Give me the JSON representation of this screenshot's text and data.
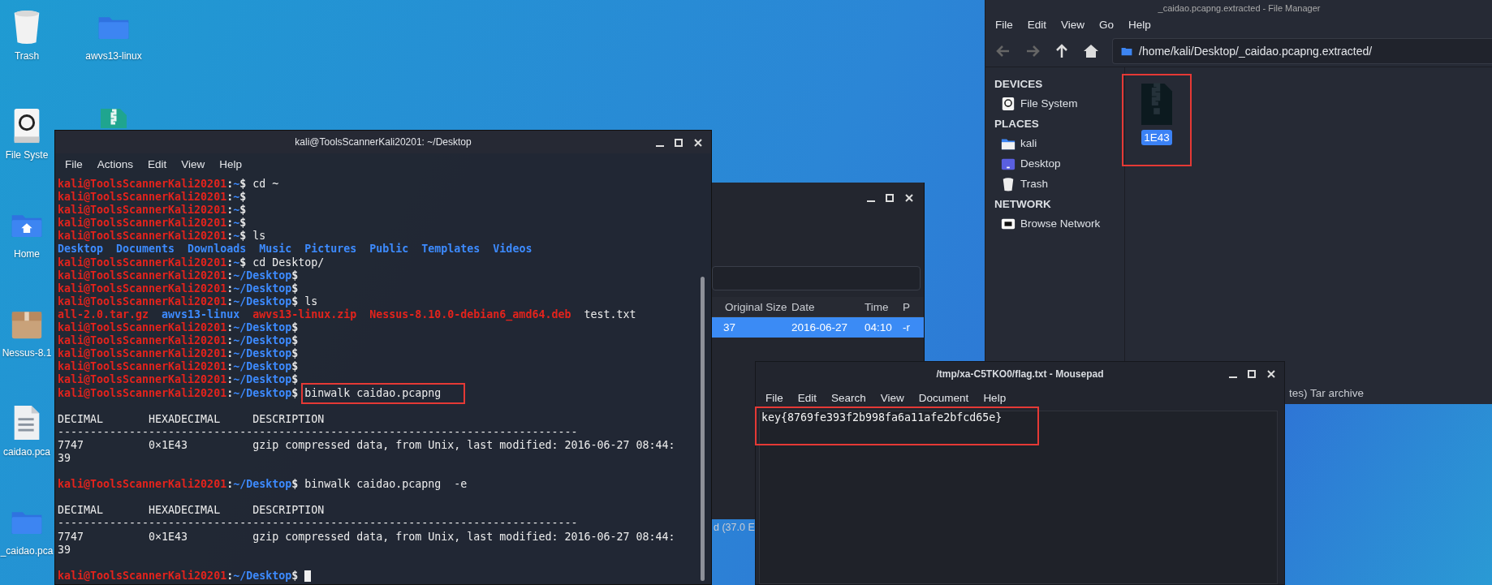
{
  "desktop": {
    "icons": [
      {
        "label": "Trash",
        "kind": "trash"
      },
      {
        "label": "awvs13-linux",
        "kind": "folder"
      },
      {
        "label": "File Syste",
        "kind": "drive"
      },
      {
        "kind": "archive"
      },
      {
        "label": "Home",
        "kind": "home"
      },
      {
        "label": "Nessus-8.1",
        "kind": "package"
      },
      {
        "label": "caidao.pca",
        "kind": "binary"
      },
      {
        "label": "_caidao.pca",
        "kind": "folder"
      }
    ]
  },
  "terminal": {
    "title": "kali@ToolsScannerKali20201: ~/Desktop",
    "menu": [
      "File",
      "Actions",
      "Edit",
      "View",
      "Help"
    ],
    "lines": [
      {
        "kind": "prompt",
        "user": "kali@ToolsScannerKali20201",
        "sep": ":",
        "path": "~",
        "sign": "$",
        "command": "cd ~"
      },
      {
        "kind": "prompt",
        "user": "kali@ToolsScannerKali20201",
        "sep": ":",
        "path": "~",
        "sign": "$"
      },
      {
        "kind": "prompt",
        "user": "kali@ToolsScannerKali20201",
        "sep": ":",
        "path": "~",
        "sign": "$"
      },
      {
        "kind": "prompt",
        "user": "kali@ToolsScannerKali20201",
        "sep": ":",
        "path": "~",
        "sign": "$"
      },
      {
        "kind": "prompt",
        "user": "kali@ToolsScannerKali20201",
        "sep": ":",
        "path": "~",
        "sign": "$",
        "command": "ls"
      },
      {
        "kind": "output",
        "parts": [
          {
            "text": "Desktop",
            "kind": "directory"
          },
          {
            "text": "Documents",
            "kind": "directory"
          },
          {
            "text": "Downloads",
            "kind": "directory"
          },
          {
            "text": "Music",
            "kind": "directory"
          },
          {
            "text": "Pictures",
            "kind": "directory"
          },
          {
            "text": "Public",
            "kind": "directory"
          },
          {
            "text": "Templates",
            "kind": "directory"
          },
          {
            "text": "Videos",
            "kind": "directory"
          }
        ]
      },
      {
        "kind": "prompt",
        "user": "kali@ToolsScannerKali20201",
        "sep": ":",
        "path": "~",
        "sign": "$",
        "command": "cd Desktop/"
      },
      {
        "kind": "prompt",
        "user": "kali@ToolsScannerKali20201",
        "sep": ":",
        "path": "~/Desktop",
        "sign": "$"
      },
      {
        "kind": "prompt",
        "user": "kali@ToolsScannerKali20201",
        "sep": ":",
        "path": "~/Desktop",
        "sign": "$"
      },
      {
        "kind": "prompt",
        "user": "kali@ToolsScannerKali20201",
        "sep": ":",
        "path": "~/Desktop",
        "sign": "$",
        "command": "ls"
      },
      {
        "kind": "output",
        "parts": [
          {
            "text": "all-2.0.tar.gz",
            "kind": "archive"
          },
          {
            "text": "awvs13-linux",
            "kind": "directory"
          },
          {
            "text": "awvs13-linux.zip",
            "kind": "archive"
          },
          {
            "text": "Nessus-8.10.0-debian6_amd64.deb",
            "kind": "archive"
          },
          {
            "text": "test.txt",
            "kind": "file"
          }
        ]
      },
      {
        "kind": "prompt",
        "user": "kali@ToolsScannerKali20201",
        "sep": ":",
        "path": "~/Desktop",
        "sign": "$"
      },
      {
        "kind": "prompt",
        "user": "kali@ToolsScannerKali20201",
        "sep": ":",
        "path": "~/Desktop",
        "sign": "$"
      },
      {
        "kind": "prompt",
        "user": "kali@ToolsScannerKali20201",
        "sep": ":",
        "path": "~/Desktop",
        "sign": "$"
      },
      {
        "kind": "prompt",
        "user": "kali@ToolsScannerKali20201",
        "sep": ":",
        "path": "~/Desktop",
        "sign": "$"
      },
      {
        "kind": "prompt",
        "user": "kali@ToolsScannerKali20201",
        "sep": ":",
        "path": "~/Desktop",
        "sign": "$"
      },
      {
        "kind": "prompt",
        "user": "kali@ToolsScannerKali20201",
        "sep": ":",
        "path": "~/Desktop",
        "sign": "$",
        "command": "binwalk caidao.pcapng",
        "highlighted": true
      },
      {
        "kind": "blank"
      },
      {
        "kind": "output",
        "text": "DECIMAL       HEXADECIMAL     DESCRIPTION"
      },
      {
        "kind": "output",
        "text": "--------------------------------------------------------------------------------"
      },
      {
        "kind": "output",
        "text": "7747          0×1E43          gzip compressed data, from Unix, last modified: 2016-06-27 08:44:"
      },
      {
        "kind": "output",
        "text": "39"
      },
      {
        "kind": "blank"
      },
      {
        "kind": "prompt",
        "user": "kali@ToolsScannerKali20201",
        "sep": ":",
        "path": "~/Desktop",
        "sign": "$",
        "command": "binwalk caidao.pcapng  -e"
      },
      {
        "kind": "blank"
      },
      {
        "kind": "output",
        "text": "DECIMAL       HEXADECIMAL     DESCRIPTION"
      },
      {
        "kind": "output",
        "text": "--------------------------------------------------------------------------------"
      },
      {
        "kind": "output",
        "text": "7747          0×1E43          gzip compressed data, from Unix, last modified: 2016-06-27 08:44:"
      },
      {
        "kind": "output",
        "text": "39"
      },
      {
        "kind": "blank"
      },
      {
        "kind": "prompt",
        "user": "kali@ToolsScannerKali20201",
        "sep": ":",
        "path": "~/Desktop",
        "sign": "$",
        "cursor": true
      }
    ]
  },
  "xarchiver": {
    "columns": [
      "Original Size",
      "Date",
      "Time",
      "P"
    ],
    "rows": [
      {
        "cells": [
          "37",
          "2016-06-27",
          "04:10",
          "-r"
        ],
        "selected": true
      }
    ],
    "status": "d (37.0 E"
  },
  "mousepad": {
    "title": "/tmp/xa-C5TKO0/flag.txt - Mousepad",
    "menu": [
      "File",
      "Edit",
      "Search",
      "View",
      "Document",
      "Help"
    ],
    "text": "key{8769fe393f2b998fa6a11afe2bfcd65e}",
    "highlighted": true
  },
  "file_manager": {
    "title": "_caidao.pcapng.extracted - File Manager",
    "menu": [
      "File",
      "Edit",
      "View",
      "Go",
      "Help"
    ],
    "path": "/home/kali/Desktop/_caidao.pcapng.extracted/",
    "sidebar": [
      {
        "heading": "DEVICES",
        "items": [
          {
            "label": "File System",
            "kind": "drive"
          }
        ]
      },
      {
        "heading": "PLACES",
        "items": [
          {
            "label": "kali",
            "kind": "home"
          },
          {
            "label": "Desktop",
            "kind": "desktop"
          },
          {
            "label": "Trash",
            "kind": "trash"
          }
        ]
      },
      {
        "heading": "NETWORK",
        "items": [
          {
            "label": "Browse Network",
            "kind": "network"
          }
        ]
      }
    ],
    "files": [
      {
        "name": "1E43",
        "selected": true,
        "highlighted": true
      }
    ],
    "status": "tes) Tar archive"
  }
}
